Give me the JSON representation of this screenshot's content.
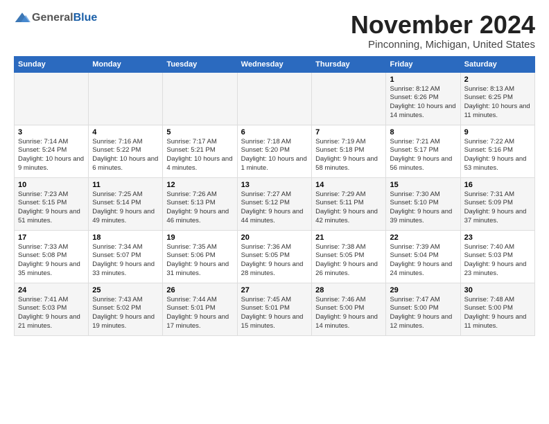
{
  "header": {
    "logo_general": "General",
    "logo_blue": "Blue",
    "month_title": "November 2024",
    "location": "Pinconning, Michigan, United States"
  },
  "weekdays": [
    "Sunday",
    "Monday",
    "Tuesday",
    "Wednesday",
    "Thursday",
    "Friday",
    "Saturday"
  ],
  "weeks": [
    [
      {
        "day": "",
        "info": ""
      },
      {
        "day": "",
        "info": ""
      },
      {
        "day": "",
        "info": ""
      },
      {
        "day": "",
        "info": ""
      },
      {
        "day": "",
        "info": ""
      },
      {
        "day": "1",
        "info": "Sunrise: 8:12 AM\nSunset: 6:26 PM\nDaylight: 10 hours and 14 minutes."
      },
      {
        "day": "2",
        "info": "Sunrise: 8:13 AM\nSunset: 6:25 PM\nDaylight: 10 hours and 11 minutes."
      }
    ],
    [
      {
        "day": "3",
        "info": "Sunrise: 7:14 AM\nSunset: 5:24 PM\nDaylight: 10 hours and 9 minutes."
      },
      {
        "day": "4",
        "info": "Sunrise: 7:16 AM\nSunset: 5:22 PM\nDaylight: 10 hours and 6 minutes."
      },
      {
        "day": "5",
        "info": "Sunrise: 7:17 AM\nSunset: 5:21 PM\nDaylight: 10 hours and 4 minutes."
      },
      {
        "day": "6",
        "info": "Sunrise: 7:18 AM\nSunset: 5:20 PM\nDaylight: 10 hours and 1 minute."
      },
      {
        "day": "7",
        "info": "Sunrise: 7:19 AM\nSunset: 5:18 PM\nDaylight: 9 hours and 58 minutes."
      },
      {
        "day": "8",
        "info": "Sunrise: 7:21 AM\nSunset: 5:17 PM\nDaylight: 9 hours and 56 minutes."
      },
      {
        "day": "9",
        "info": "Sunrise: 7:22 AM\nSunset: 5:16 PM\nDaylight: 9 hours and 53 minutes."
      }
    ],
    [
      {
        "day": "10",
        "info": "Sunrise: 7:23 AM\nSunset: 5:15 PM\nDaylight: 9 hours and 51 minutes."
      },
      {
        "day": "11",
        "info": "Sunrise: 7:25 AM\nSunset: 5:14 PM\nDaylight: 9 hours and 49 minutes."
      },
      {
        "day": "12",
        "info": "Sunrise: 7:26 AM\nSunset: 5:13 PM\nDaylight: 9 hours and 46 minutes."
      },
      {
        "day": "13",
        "info": "Sunrise: 7:27 AM\nSunset: 5:12 PM\nDaylight: 9 hours and 44 minutes."
      },
      {
        "day": "14",
        "info": "Sunrise: 7:29 AM\nSunset: 5:11 PM\nDaylight: 9 hours and 42 minutes."
      },
      {
        "day": "15",
        "info": "Sunrise: 7:30 AM\nSunset: 5:10 PM\nDaylight: 9 hours and 39 minutes."
      },
      {
        "day": "16",
        "info": "Sunrise: 7:31 AM\nSunset: 5:09 PM\nDaylight: 9 hours and 37 minutes."
      }
    ],
    [
      {
        "day": "17",
        "info": "Sunrise: 7:33 AM\nSunset: 5:08 PM\nDaylight: 9 hours and 35 minutes."
      },
      {
        "day": "18",
        "info": "Sunrise: 7:34 AM\nSunset: 5:07 PM\nDaylight: 9 hours and 33 minutes."
      },
      {
        "day": "19",
        "info": "Sunrise: 7:35 AM\nSunset: 5:06 PM\nDaylight: 9 hours and 31 minutes."
      },
      {
        "day": "20",
        "info": "Sunrise: 7:36 AM\nSunset: 5:05 PM\nDaylight: 9 hours and 28 minutes."
      },
      {
        "day": "21",
        "info": "Sunrise: 7:38 AM\nSunset: 5:05 PM\nDaylight: 9 hours and 26 minutes."
      },
      {
        "day": "22",
        "info": "Sunrise: 7:39 AM\nSunset: 5:04 PM\nDaylight: 9 hours and 24 minutes."
      },
      {
        "day": "23",
        "info": "Sunrise: 7:40 AM\nSunset: 5:03 PM\nDaylight: 9 hours and 23 minutes."
      }
    ],
    [
      {
        "day": "24",
        "info": "Sunrise: 7:41 AM\nSunset: 5:03 PM\nDaylight: 9 hours and 21 minutes."
      },
      {
        "day": "25",
        "info": "Sunrise: 7:43 AM\nSunset: 5:02 PM\nDaylight: 9 hours and 19 minutes."
      },
      {
        "day": "26",
        "info": "Sunrise: 7:44 AM\nSunset: 5:01 PM\nDaylight: 9 hours and 17 minutes."
      },
      {
        "day": "27",
        "info": "Sunrise: 7:45 AM\nSunset: 5:01 PM\nDaylight: 9 hours and 15 minutes."
      },
      {
        "day": "28",
        "info": "Sunrise: 7:46 AM\nSunset: 5:00 PM\nDaylight: 9 hours and 14 minutes."
      },
      {
        "day": "29",
        "info": "Sunrise: 7:47 AM\nSunset: 5:00 PM\nDaylight: 9 hours and 12 minutes."
      },
      {
        "day": "30",
        "info": "Sunrise: 7:48 AM\nSunset: 5:00 PM\nDaylight: 9 hours and 11 minutes."
      }
    ]
  ]
}
